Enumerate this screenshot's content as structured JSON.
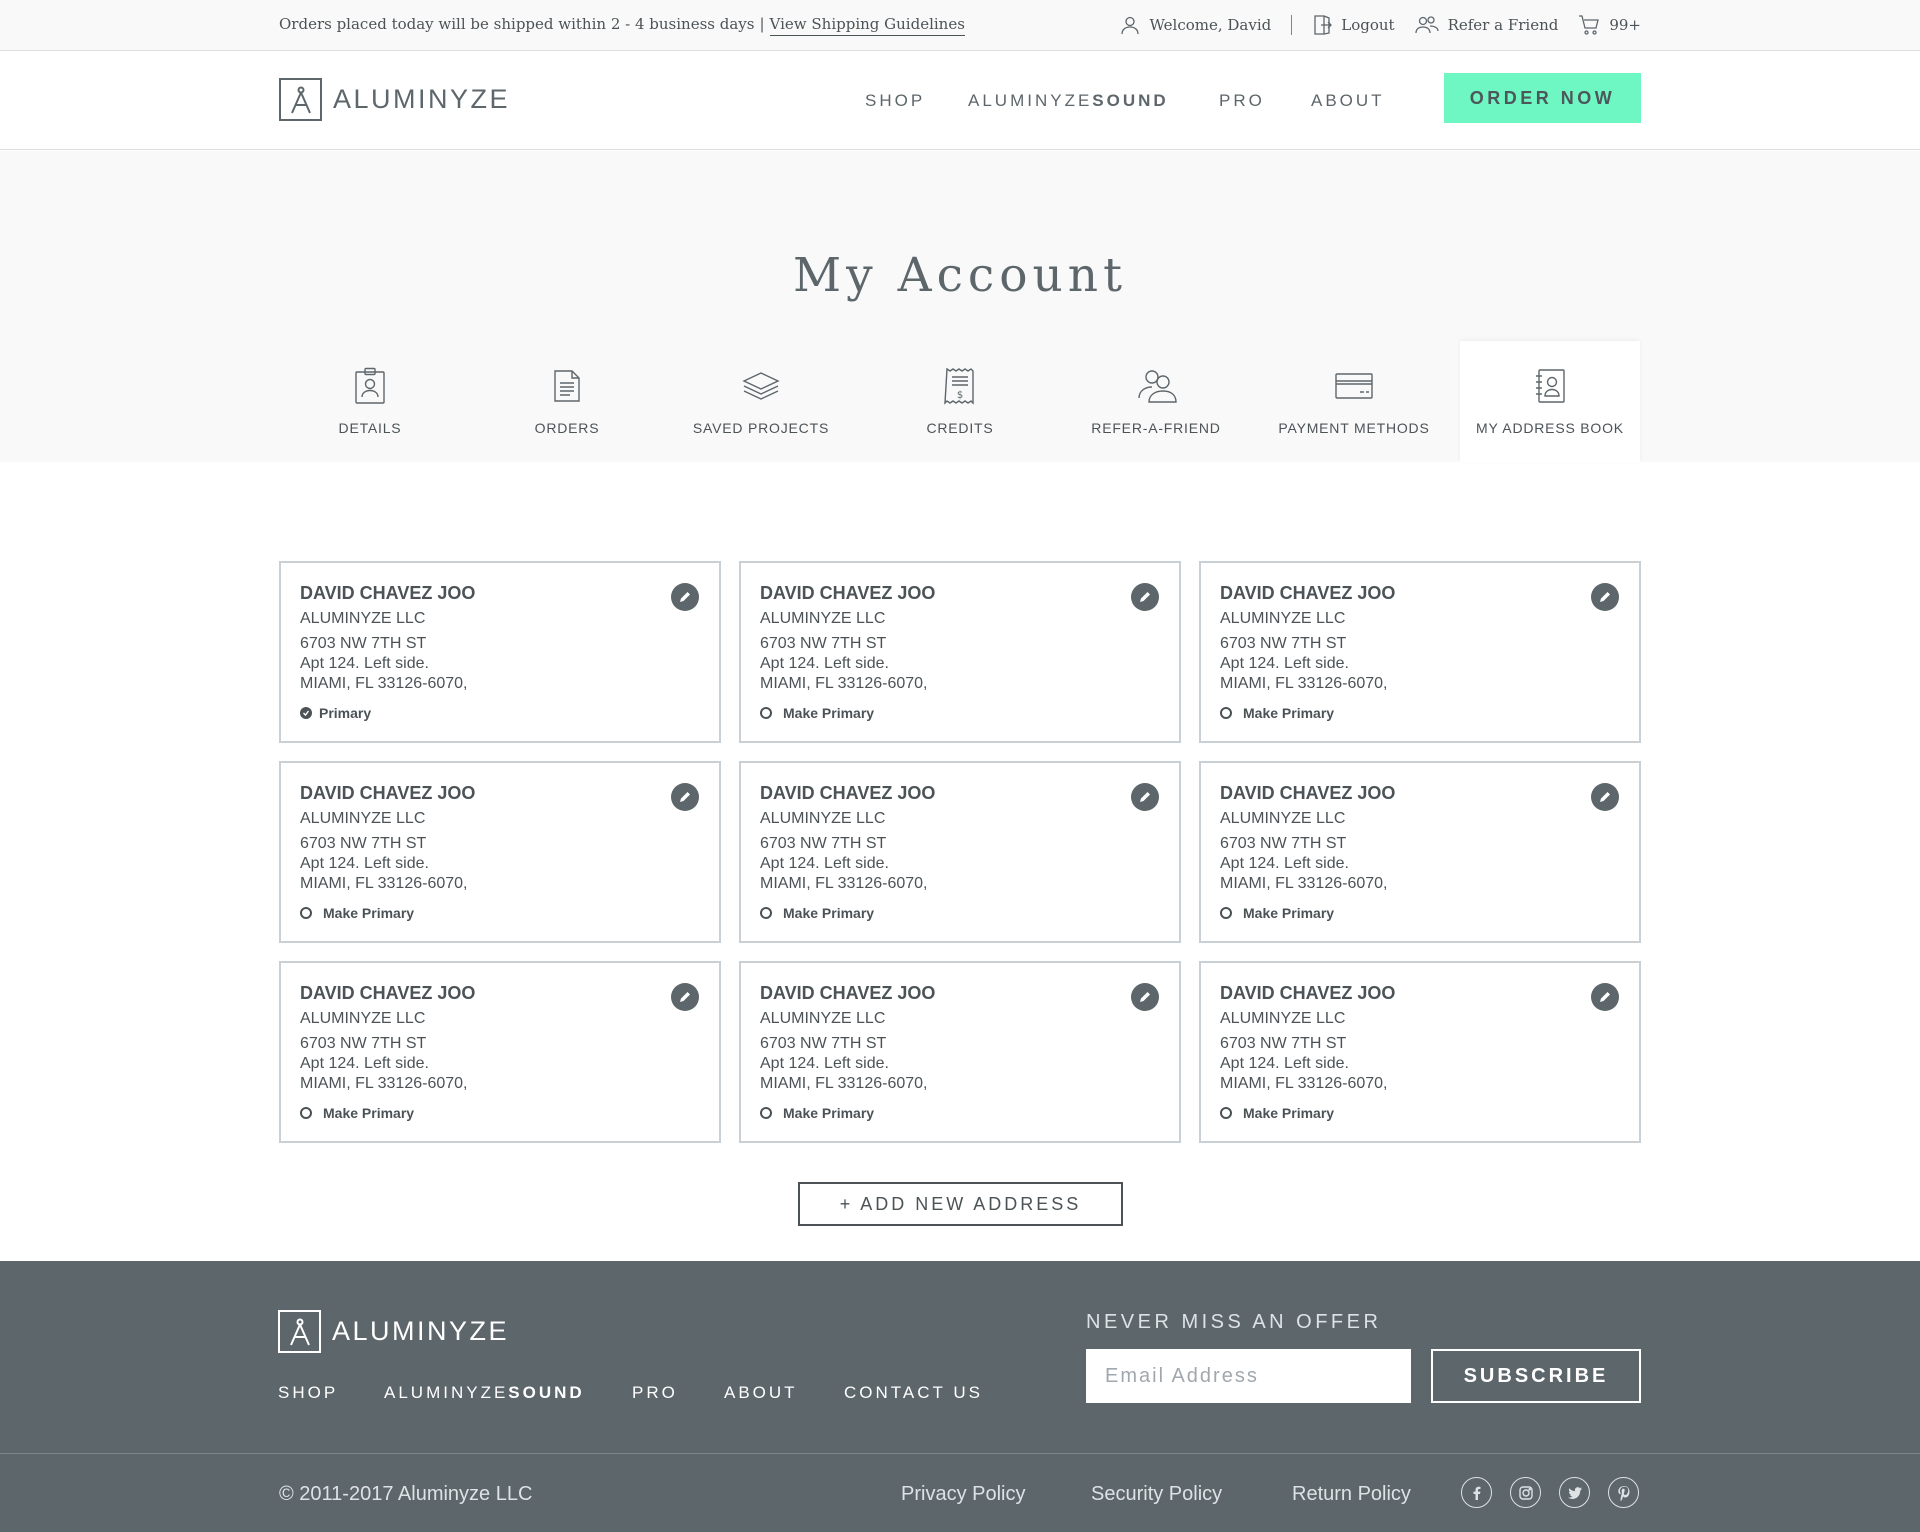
{
  "topbar": {
    "notice": "Orders placed today will be shipped within 2 - 4 business days",
    "separator": "|",
    "guidelines_link": "View Shipping Guidelines",
    "welcome": "Welcome, David",
    "logout": "Logout",
    "refer": "Refer a Friend",
    "cart_count": "99+"
  },
  "header": {
    "logo_text": "ALUMINYZE",
    "nav": {
      "shop": "SHOP",
      "sound_prefix": "ALUMINYZE",
      "sound_suffix": "SOUND",
      "pro": "PRO",
      "about": "ABOUT"
    },
    "order_button": "ORDER NOW",
    "accent_color": "#6ef7c2"
  },
  "page_title": "My Account",
  "tabs": [
    {
      "label": "DETAILS",
      "icon": "id-badge-icon",
      "active": false
    },
    {
      "label": "ORDERS",
      "icon": "document-icon",
      "active": false
    },
    {
      "label": "SAVED PROJECTS",
      "icon": "layers-icon",
      "active": false
    },
    {
      "label": "CREDITS",
      "icon": "receipt-icon",
      "active": false
    },
    {
      "label": "REFER-A-FRIEND",
      "icon": "people-icon",
      "active": false
    },
    {
      "label": "PAYMENT METHODS",
      "icon": "credit-card-icon",
      "active": false
    },
    {
      "label": "MY ADDRESS BOOK",
      "icon": "address-book-icon",
      "active": true
    }
  ],
  "addresses": [
    {
      "name": "DAVID CHAVEZ JOO",
      "company": "ALUMINYZE LLC",
      "street": "6703 NW 7TH ST",
      "unit": "Apt 124. Left side.",
      "city": "MIAMI, FL 33126-6070,",
      "status": "Primary",
      "primary": true
    },
    {
      "name": "DAVID CHAVEZ JOO",
      "company": "ALUMINYZE LLC",
      "street": "6703 NW 7TH ST",
      "unit": "Apt 124. Left side.",
      "city": "MIAMI, FL 33126-6070,",
      "status": "Make Primary",
      "primary": false
    },
    {
      "name": "DAVID CHAVEZ JOO",
      "company": "ALUMINYZE LLC",
      "street": "6703 NW 7TH ST",
      "unit": "Apt 124. Left side.",
      "city": "MIAMI, FL 33126-6070,",
      "status": "Make Primary",
      "primary": false
    },
    {
      "name": "DAVID CHAVEZ JOO",
      "company": "ALUMINYZE LLC",
      "street": "6703 NW 7TH ST",
      "unit": "Apt 124. Left side.",
      "city": "MIAMI, FL 33126-6070,",
      "status": "Make Primary",
      "primary": false
    },
    {
      "name": "DAVID CHAVEZ JOO",
      "company": "ALUMINYZE LLC",
      "street": "6703 NW 7TH ST",
      "unit": "Apt 124. Left side.",
      "city": "MIAMI, FL 33126-6070,",
      "status": "Make Primary",
      "primary": false
    },
    {
      "name": "DAVID CHAVEZ JOO",
      "company": "ALUMINYZE LLC",
      "street": "6703 NW 7TH ST",
      "unit": "Apt 124. Left side.",
      "city": "MIAMI, FL 33126-6070,",
      "status": "Make Primary",
      "primary": false
    },
    {
      "name": "DAVID CHAVEZ JOO",
      "company": "ALUMINYZE LLC",
      "street": "6703 NW 7TH ST",
      "unit": "Apt 124. Left side.",
      "city": "MIAMI, FL 33126-6070,",
      "status": "Make Primary",
      "primary": false
    },
    {
      "name": "DAVID CHAVEZ JOO",
      "company": "ALUMINYZE LLC",
      "street": "6703 NW 7TH ST",
      "unit": "Apt 124. Left side.",
      "city": "MIAMI, FL 33126-6070,",
      "status": "Make Primary",
      "primary": false
    },
    {
      "name": "DAVID CHAVEZ JOO",
      "company": "ALUMINYZE LLC",
      "street": "6703 NW 7TH ST",
      "unit": "Apt 124. Left side.",
      "city": "MIAMI, FL 33126-6070,",
      "status": "Make Primary",
      "primary": false
    }
  ],
  "add_address_button": "+ ADD NEW ADDRESS",
  "footer": {
    "logo_text": "ALUMINYZE",
    "nav": {
      "shop": "SHOP",
      "sound_prefix": "ALUMINYZE",
      "sound_suffix": "SOUND",
      "pro": "PRO",
      "about": "ABOUT",
      "contact": "CONTACT US"
    },
    "offer_heading": "NEVER MISS AN OFFER",
    "email_placeholder": "Email Address",
    "subscribe_button": "SUBSCRIBE",
    "copyright": "© 2011-2017 Aluminyze LLC",
    "privacy": "Privacy Policy",
    "security": "Security Policy",
    "returns": "Return Policy",
    "social": [
      "facebook-icon",
      "instagram-icon",
      "twitter-icon",
      "pinterest-icon"
    ]
  }
}
